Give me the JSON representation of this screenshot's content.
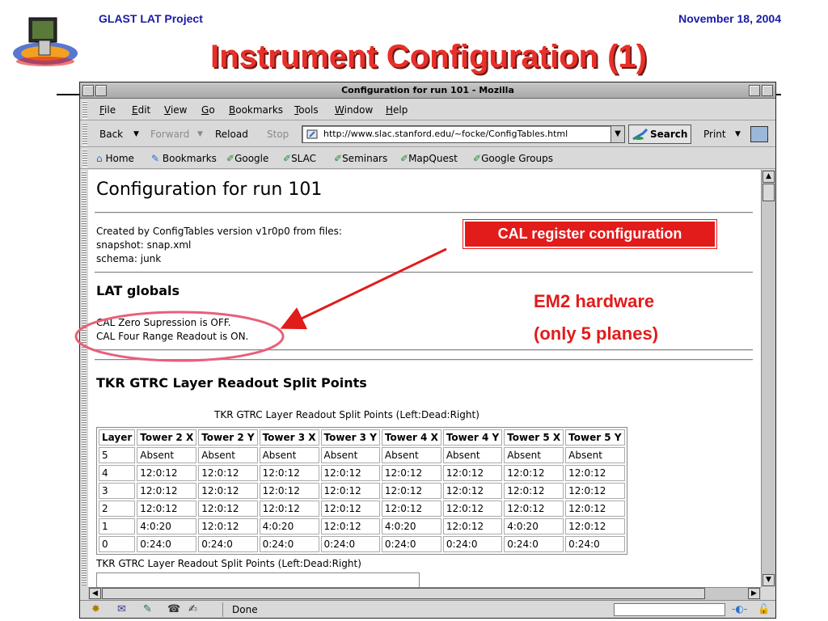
{
  "slide": {
    "header_left": "GLAST LAT Project",
    "header_right": "November 18, 2004",
    "title": "Instrument Configuration (1)"
  },
  "browser": {
    "window_title": "Configuration for run 101 - Mozilla",
    "menu": [
      "File",
      "Edit",
      "View",
      "Go",
      "Bookmarks",
      "Tools",
      "Window",
      "Help"
    ],
    "nav": {
      "back": "Back",
      "forward": "Forward",
      "reload": "Reload",
      "stop": "Stop",
      "url": "http://www.slac.stanford.edu/~focke/ConfigTables.html",
      "search": "Search",
      "print": "Print"
    },
    "personal_toolbar": [
      "Home",
      "Bookmarks",
      "Google",
      "SLAC",
      "Seminars",
      "MapQuest",
      "Google Groups"
    ],
    "status": "Done"
  },
  "page": {
    "heading": "Configuration for run 101",
    "created_line": "Created by ConfigTables version v1r0p0 from files:",
    "snapshot_line": "snapshot: snap.xml",
    "schema_line": "schema: junk",
    "lat_globals_heading": "LAT globals",
    "cal_zero": "CAL Zero Supression is OFF.",
    "cal_four": "CAL Four Range Readout is ON.",
    "tkr_heading": "TKR GTRC Layer Readout Split Points",
    "table_caption": "TKR GTRC Layer Readout Split Points (Left:Dead:Right)",
    "table_headers": [
      "Layer",
      "Tower 2 X",
      "Tower 2 Y",
      "Tower 3 X",
      "Tower 3 Y",
      "Tower 4 X",
      "Tower 4 Y",
      "Tower 5 X",
      "Tower 5 Y"
    ],
    "table_rows": [
      [
        "5",
        "Absent",
        "Absent",
        "Absent",
        "Absent",
        "Absent",
        "Absent",
        "Absent",
        "Absent"
      ],
      [
        "4",
        "12:0:12",
        "12:0:12",
        "12:0:12",
        "12:0:12",
        "12:0:12",
        "12:0:12",
        "12:0:12",
        "12:0:12"
      ],
      [
        "3",
        "12:0:12",
        "12:0:12",
        "12:0:12",
        "12:0:12",
        "12:0:12",
        "12:0:12",
        "12:0:12",
        "12:0:12"
      ],
      [
        "2",
        "12:0:12",
        "12:0:12",
        "12:0:12",
        "12:0:12",
        "12:0:12",
        "12:0:12",
        "12:0:12",
        "12:0:12"
      ],
      [
        "1",
        "4:0:20",
        "12:0:12",
        "4:0:20",
        "12:0:12",
        "4:0:20",
        "12:0:12",
        "4:0:20",
        "12:0:12"
      ],
      [
        "0",
        "0:24:0",
        "0:24:0",
        "0:24:0",
        "0:24:0",
        "0:24:0",
        "0:24:0",
        "0:24:0",
        "0:24:0"
      ]
    ],
    "table_caption_2": "TKR GTRC Layer Readout Split Points (Left:Dead:Right)"
  },
  "annotations": {
    "callout": "CAL register configuration",
    "em2_line1": "EM2 hardware",
    "em2_line2": "(only 5 planes)"
  },
  "colors": {
    "slide_title": "#e8302a",
    "header_text": "#1a1aa6",
    "annotation_red": "#e21b1b",
    "ellipse_pink": "#e8607a"
  }
}
